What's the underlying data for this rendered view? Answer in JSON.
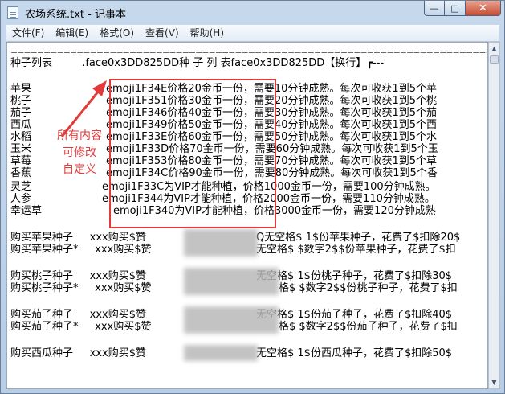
{
  "window": {
    "title": "农场系统.txt - 记事本",
    "min_glyph": "—",
    "max_glyph": "□",
    "close_glyph": "✕"
  },
  "menu": [
    "文件(F)",
    "编辑(E)",
    "格式(O)",
    "查看(V)",
    "帮助(H)"
  ],
  "lines": {
    "separator": "===================================================================================",
    "header": "种子列表         .face0x3DD825DD种 子 列 表face0x3DD825DD【换行】┏---",
    "seeds": [
      {
        "name": "苹果",
        "desc": "emoji1F34E价格20金币一份，需要10分钟成熟。每次可收获1到5个苹"
      },
      {
        "name": "桃子",
        "desc": "emoji1F351价格30金币一份，需要20分钟成熟。每次可收获1到5个桃"
      },
      {
        "name": "茄子",
        "desc": "emoji1F346价格40金币一份，需要30分钟成熟。每次可收获1到5个茄"
      },
      {
        "name": "西瓜",
        "desc": "emoji1F349价格50金币一份，需要40分钟成熟。每次可收获1到5个西"
      },
      {
        "name": "水稻",
        "desc": "emoji1F33E价格60金币一份，需要50分钟成熟。每次可收获1到5个水"
      },
      {
        "name": "玉米",
        "desc": "emoji1F33D价格70金币一份，需要60分钟成熟。每次可收获1到5个玉"
      },
      {
        "name": "草莓",
        "desc": "emoji1F353价格80金币一份，需要70分钟成熟。每次可收获1到5个草"
      },
      {
        "name": "香蕉",
        "desc": "emoji1F34C价格90金币一份，需要80分钟成熟。每次可收获1到5个香"
      }
    ],
    "vip": [
      {
        "name": "灵芝",
        "desc": "emoji1F33C为VIP才能种植，价格1000金币一份，需要100分钟成熟。"
      },
      {
        "name": "人参",
        "desc": "emoji1F344为VIP才能种植，价格2000金币一份，需要110分钟成熟。"
      },
      {
        "name": "幸运草",
        "desc": "emoji1F340为VIP才能种植，价格3000金币一份，需要120分钟成熟"
      }
    ],
    "buy": [
      {
        "a": "购买苹果种子     xxx购买$赞",
        "b": "Q无空格$ 1$份苹果种子，花费了$扣除20$"
      },
      {
        "a": "购买苹果种子*     xxx购买$赞",
        "b": "无空格$ $数字2$$份苹果种子，花费了$扣"
      },
      {
        "a": "购买桃子种子     xxx购买$赞",
        "b": "无空格$ 1$份桃子种子，花费了$扣除30$"
      },
      {
        "a": "购买桃子种子*     xxx购买$赞",
        "b": "格$ $数字2$$份桃子种子，花费了$扣"
      },
      {
        "a": "购买茄子种子     xxx购买$赞",
        "b": "无空格$ 1$份茄子种子，花费了$扣除40$"
      },
      {
        "a": "购买茄子种子*     xxx购买$赞",
        "b": "格$ $数字2$$份茄子种子，花费了$扣"
      },
      {
        "a": "购买西瓜种子     xxx购买$赞",
        "b": "无空格$ 1$份西瓜种子，花费了$扣除50$"
      }
    ]
  },
  "annotation": "所有内容\n可修改\n自定义",
  "colors": {
    "annotation": "#e23a3a",
    "chrome": "#c6d8ec"
  },
  "icons": [
    "notepad-icon",
    "minimize-icon",
    "maximize-icon",
    "close-icon",
    "scroll-up-icon",
    "scroll-down-icon"
  ]
}
